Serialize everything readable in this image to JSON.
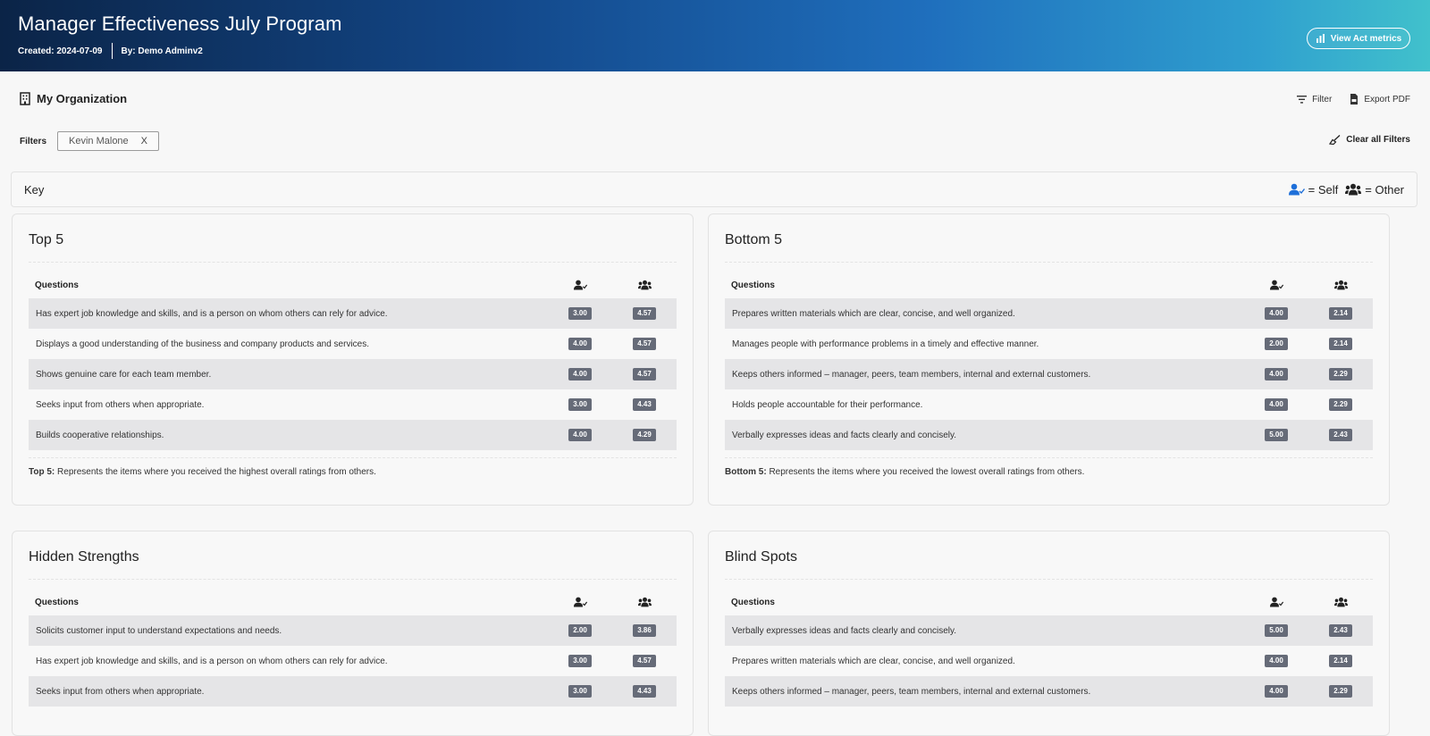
{
  "header": {
    "title": "Manager Effectiveness July Program",
    "created": "Created: 2024-07-09",
    "by": "By: Demo Adminv2",
    "act_metrics_button": "View Act metrics"
  },
  "toolbar": {
    "org_label": "My Organization",
    "filter_label": "Filter",
    "export_label": "Export PDF"
  },
  "filters": {
    "label": "Filters",
    "chips": [
      {
        "label": "Kevin Malone",
        "remove": "X"
      }
    ],
    "clear_all": "Clear all Filters"
  },
  "key": {
    "title": "Key",
    "self_label": "= Self",
    "other_label": "= Other"
  },
  "colors": {
    "banner_start": "#0b2447",
    "banner_end": "#41c1cc",
    "score_badge": "#666b78",
    "self_icon": "#1e6fd9"
  },
  "panels": {
    "top5": {
      "title": "Top 5",
      "questions_header": "Questions",
      "rows": [
        {
          "q": "Has expert job knowledge and skills, and is a person on whom others can rely for advice.",
          "self": "3.00",
          "other": "4.57"
        },
        {
          "q": "Displays a good understanding of the business and company products and services.",
          "self": "4.00",
          "other": "4.57"
        },
        {
          "q": "Shows genuine care for each team member.",
          "self": "4.00",
          "other": "4.57"
        },
        {
          "q": "Seeks input from others when appropriate.",
          "self": "3.00",
          "other": "4.43"
        },
        {
          "q": "Builds cooperative relationships.",
          "self": "4.00",
          "other": "4.29"
        }
      ],
      "note_bold": "Top 5:",
      "note": " Represents the items where you received the highest overall ratings from others."
    },
    "bottom5": {
      "title": "Bottom 5",
      "questions_header": "Questions",
      "rows": [
        {
          "q": "Prepares written materials which are clear, concise, and well organized.",
          "self": "4.00",
          "other": "2.14"
        },
        {
          "q": "Manages people with performance problems in a timely and effective manner.",
          "self": "2.00",
          "other": "2.14"
        },
        {
          "q": "Keeps others informed – manager, peers, team members, internal and external customers.",
          "self": "4.00",
          "other": "2.29"
        },
        {
          "q": "Holds people accountable for their performance.",
          "self": "4.00",
          "other": "2.29"
        },
        {
          "q": "Verbally expresses ideas and facts clearly and concisely.",
          "self": "5.00",
          "other": "2.43"
        }
      ],
      "note_bold": "Bottom 5:",
      "note": " Represents the items where you received the lowest overall ratings from others."
    },
    "hidden": {
      "title": "Hidden Strengths",
      "questions_header": "Questions",
      "rows": [
        {
          "q": "Solicits customer input to understand expectations and needs.",
          "self": "2.00",
          "other": "3.86"
        },
        {
          "q": "Has expert job knowledge and skills, and is a person on whom others can rely for advice.",
          "self": "3.00",
          "other": "4.57"
        },
        {
          "q": "Seeks input from others when appropriate.",
          "self": "3.00",
          "other": "4.43"
        }
      ]
    },
    "blind": {
      "title": "Blind Spots",
      "questions_header": "Questions",
      "rows": [
        {
          "q": "Verbally expresses ideas and facts clearly and concisely.",
          "self": "5.00",
          "other": "2.43"
        },
        {
          "q": "Prepares written materials which are clear, concise, and well organized.",
          "self": "4.00",
          "other": "2.14"
        },
        {
          "q": "Keeps others informed – manager, peers, team members, internal and external customers.",
          "self": "4.00",
          "other": "2.29"
        }
      ]
    }
  }
}
